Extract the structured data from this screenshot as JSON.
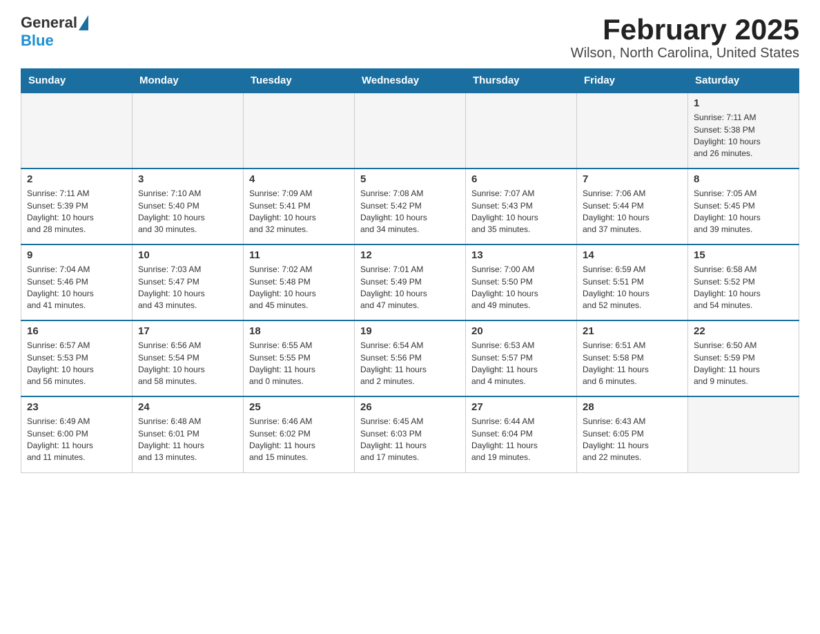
{
  "logo": {
    "general": "General",
    "blue": "Blue"
  },
  "title": "February 2025",
  "subtitle": "Wilson, North Carolina, United States",
  "weekdays": [
    "Sunday",
    "Monday",
    "Tuesday",
    "Wednesday",
    "Thursday",
    "Friday",
    "Saturday"
  ],
  "weeks": [
    [
      {
        "day": "",
        "info": ""
      },
      {
        "day": "",
        "info": ""
      },
      {
        "day": "",
        "info": ""
      },
      {
        "day": "",
        "info": ""
      },
      {
        "day": "",
        "info": ""
      },
      {
        "day": "",
        "info": ""
      },
      {
        "day": "1",
        "info": "Sunrise: 7:11 AM\nSunset: 5:38 PM\nDaylight: 10 hours\nand 26 minutes."
      }
    ],
    [
      {
        "day": "2",
        "info": "Sunrise: 7:11 AM\nSunset: 5:39 PM\nDaylight: 10 hours\nand 28 minutes."
      },
      {
        "day": "3",
        "info": "Sunrise: 7:10 AM\nSunset: 5:40 PM\nDaylight: 10 hours\nand 30 minutes."
      },
      {
        "day": "4",
        "info": "Sunrise: 7:09 AM\nSunset: 5:41 PM\nDaylight: 10 hours\nand 32 minutes."
      },
      {
        "day": "5",
        "info": "Sunrise: 7:08 AM\nSunset: 5:42 PM\nDaylight: 10 hours\nand 34 minutes."
      },
      {
        "day": "6",
        "info": "Sunrise: 7:07 AM\nSunset: 5:43 PM\nDaylight: 10 hours\nand 35 minutes."
      },
      {
        "day": "7",
        "info": "Sunrise: 7:06 AM\nSunset: 5:44 PM\nDaylight: 10 hours\nand 37 minutes."
      },
      {
        "day": "8",
        "info": "Sunrise: 7:05 AM\nSunset: 5:45 PM\nDaylight: 10 hours\nand 39 minutes."
      }
    ],
    [
      {
        "day": "9",
        "info": "Sunrise: 7:04 AM\nSunset: 5:46 PM\nDaylight: 10 hours\nand 41 minutes."
      },
      {
        "day": "10",
        "info": "Sunrise: 7:03 AM\nSunset: 5:47 PM\nDaylight: 10 hours\nand 43 minutes."
      },
      {
        "day": "11",
        "info": "Sunrise: 7:02 AM\nSunset: 5:48 PM\nDaylight: 10 hours\nand 45 minutes."
      },
      {
        "day": "12",
        "info": "Sunrise: 7:01 AM\nSunset: 5:49 PM\nDaylight: 10 hours\nand 47 minutes."
      },
      {
        "day": "13",
        "info": "Sunrise: 7:00 AM\nSunset: 5:50 PM\nDaylight: 10 hours\nand 49 minutes."
      },
      {
        "day": "14",
        "info": "Sunrise: 6:59 AM\nSunset: 5:51 PM\nDaylight: 10 hours\nand 52 minutes."
      },
      {
        "day": "15",
        "info": "Sunrise: 6:58 AM\nSunset: 5:52 PM\nDaylight: 10 hours\nand 54 minutes."
      }
    ],
    [
      {
        "day": "16",
        "info": "Sunrise: 6:57 AM\nSunset: 5:53 PM\nDaylight: 10 hours\nand 56 minutes."
      },
      {
        "day": "17",
        "info": "Sunrise: 6:56 AM\nSunset: 5:54 PM\nDaylight: 10 hours\nand 58 minutes."
      },
      {
        "day": "18",
        "info": "Sunrise: 6:55 AM\nSunset: 5:55 PM\nDaylight: 11 hours\nand 0 minutes."
      },
      {
        "day": "19",
        "info": "Sunrise: 6:54 AM\nSunset: 5:56 PM\nDaylight: 11 hours\nand 2 minutes."
      },
      {
        "day": "20",
        "info": "Sunrise: 6:53 AM\nSunset: 5:57 PM\nDaylight: 11 hours\nand 4 minutes."
      },
      {
        "day": "21",
        "info": "Sunrise: 6:51 AM\nSunset: 5:58 PM\nDaylight: 11 hours\nand 6 minutes."
      },
      {
        "day": "22",
        "info": "Sunrise: 6:50 AM\nSunset: 5:59 PM\nDaylight: 11 hours\nand 9 minutes."
      }
    ],
    [
      {
        "day": "23",
        "info": "Sunrise: 6:49 AM\nSunset: 6:00 PM\nDaylight: 11 hours\nand 11 minutes."
      },
      {
        "day": "24",
        "info": "Sunrise: 6:48 AM\nSunset: 6:01 PM\nDaylight: 11 hours\nand 13 minutes."
      },
      {
        "day": "25",
        "info": "Sunrise: 6:46 AM\nSunset: 6:02 PM\nDaylight: 11 hours\nand 15 minutes."
      },
      {
        "day": "26",
        "info": "Sunrise: 6:45 AM\nSunset: 6:03 PM\nDaylight: 11 hours\nand 17 minutes."
      },
      {
        "day": "27",
        "info": "Sunrise: 6:44 AM\nSunset: 6:04 PM\nDaylight: 11 hours\nand 19 minutes."
      },
      {
        "day": "28",
        "info": "Sunrise: 6:43 AM\nSunset: 6:05 PM\nDaylight: 11 hours\nand 22 minutes."
      },
      {
        "day": "",
        "info": ""
      }
    ]
  ]
}
